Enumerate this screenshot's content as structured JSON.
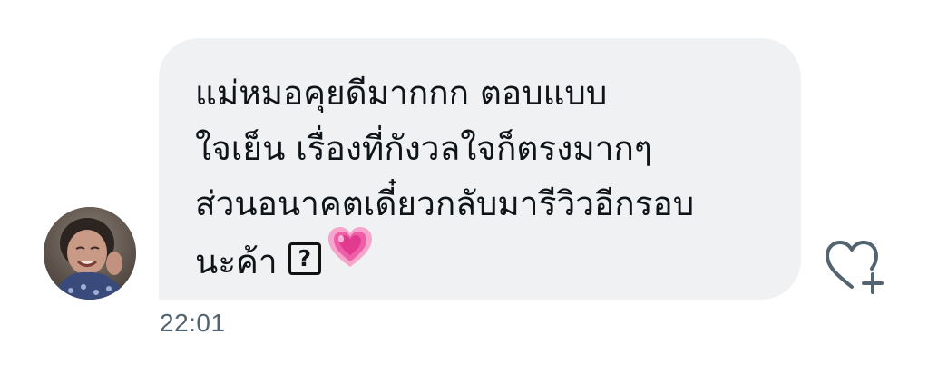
{
  "message": {
    "lines": [
      "แม่หมอคุยดีมากกก ตอบแบบ",
      "ใจเย็น เรื่องที่กังวลใจก็ตรงมากๆ",
      "ส่วนอนาคตเดี๋ยวกลับมารีวิวอีกรอบ",
      "นะค้า"
    ],
    "unknown_glyph": "?",
    "emoji": "growing-heart-emoji"
  },
  "timestamp": "22:01",
  "icons": {
    "avatar": "avatar-photo",
    "like": "heart-plus-icon"
  },
  "colors": {
    "bubble": "#eff1f3",
    "text": "#0f1419",
    "timestamp": "#536471",
    "heart_emoji": "#f06aa8",
    "like_icon": "#536471"
  }
}
